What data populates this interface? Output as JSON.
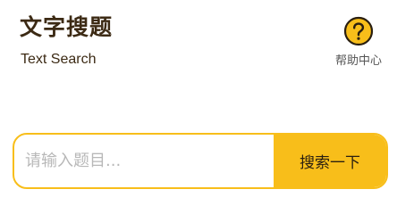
{
  "header": {
    "title": "文字搜题",
    "subtitle": "Text Search"
  },
  "help": {
    "icon": "question-circle-icon",
    "label": "帮助中心"
  },
  "search": {
    "placeholder": "请输入题目...",
    "value": "",
    "button_label": "搜索一下"
  },
  "colors": {
    "accent": "#f8be1a",
    "text_dark": "#3c2a14",
    "placeholder": "#b8b8b8",
    "background": "#ffffff"
  }
}
